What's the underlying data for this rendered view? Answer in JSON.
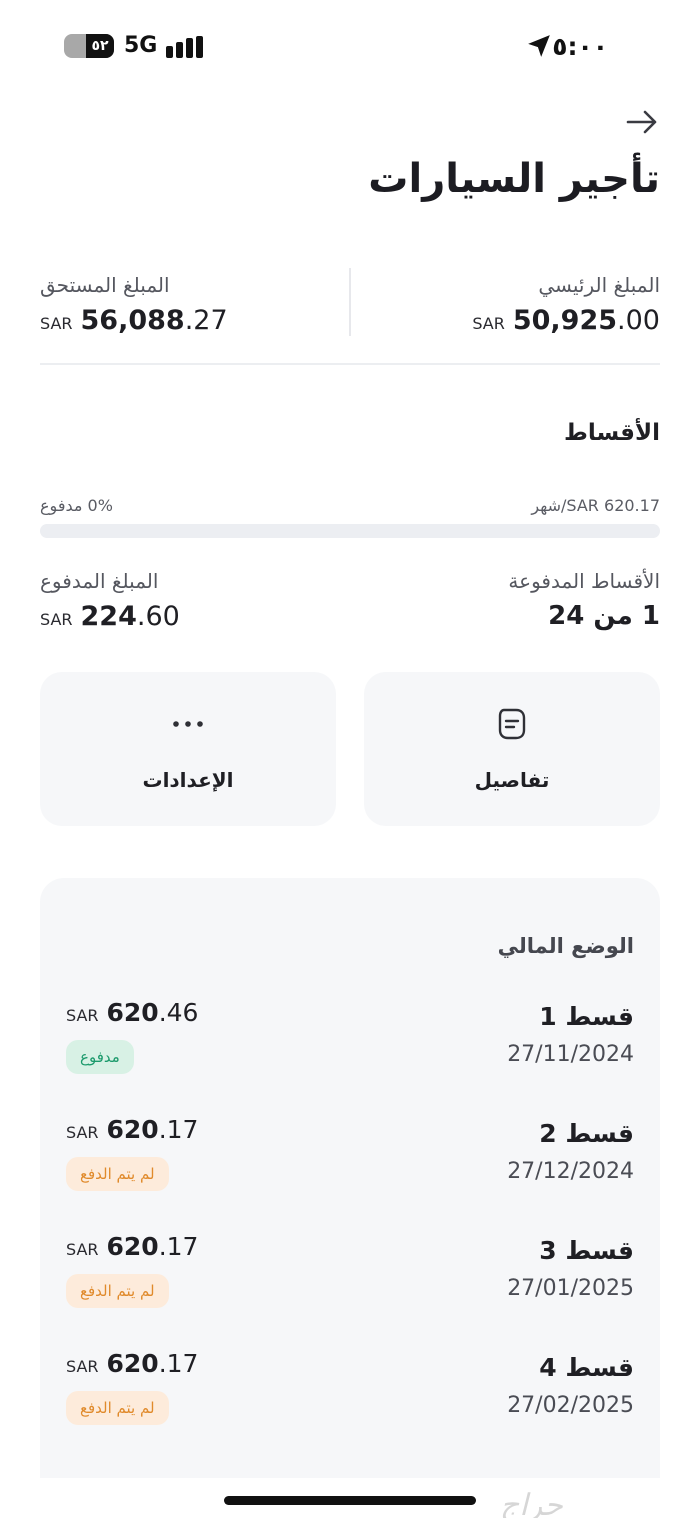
{
  "status_bar": {
    "time": "٥:٠٠",
    "battery": "٥٢",
    "network": "5G"
  },
  "header": {
    "title": "تأجير السيارات"
  },
  "amounts": {
    "principal": {
      "label": "المبلغ الرئيسي",
      "currency": "SAR",
      "integer": "50,925",
      "decimal": ".00"
    },
    "due": {
      "label": "المبلغ المستحق",
      "currency": "SAR",
      "integer": "56,088",
      "decimal": ".27"
    }
  },
  "installments": {
    "title": "الأقساط",
    "monthly_text": "SAR 620.17/شهر",
    "progress_text": "0% مدفوع",
    "progress_fraction": 0.0,
    "paid_installments": {
      "label": "الأقساط المدفوعة",
      "value": "1 من 24"
    },
    "paid_amount": {
      "label": "المبلغ المدفوع",
      "currency": "SAR",
      "integer": "224",
      "decimal": ".60"
    }
  },
  "actions": {
    "details_label": "تفاصيل",
    "settings_label": "الإعدادات"
  },
  "financial_status": {
    "title": "الوضع المالي",
    "items": [
      {
        "name": "قسط 1",
        "date": "27/11/2024",
        "currency": "SAR",
        "integer": "620",
        "decimal": ".46",
        "status": "مدفوع",
        "status_type": "paid"
      },
      {
        "name": "قسط 2",
        "date": "27/12/2024",
        "currency": "SAR",
        "integer": "620",
        "decimal": ".17",
        "status": "لم يتم الدفع",
        "status_type": "unpaid"
      },
      {
        "name": "قسط 3",
        "date": "27/01/2025",
        "currency": "SAR",
        "integer": "620",
        "decimal": ".17",
        "status": "لم يتم الدفع",
        "status_type": "unpaid"
      },
      {
        "name": "قسط 4",
        "date": "27/02/2025",
        "currency": "SAR",
        "integer": "620",
        "decimal": ".17",
        "status": "لم يتم الدفع",
        "status_type": "unpaid"
      }
    ]
  },
  "watermark": "حراج",
  "colors": {
    "accent_green": "#1c9a6c",
    "warning_orange": "#e08a2b",
    "card_bg": "#f6f7f9"
  }
}
